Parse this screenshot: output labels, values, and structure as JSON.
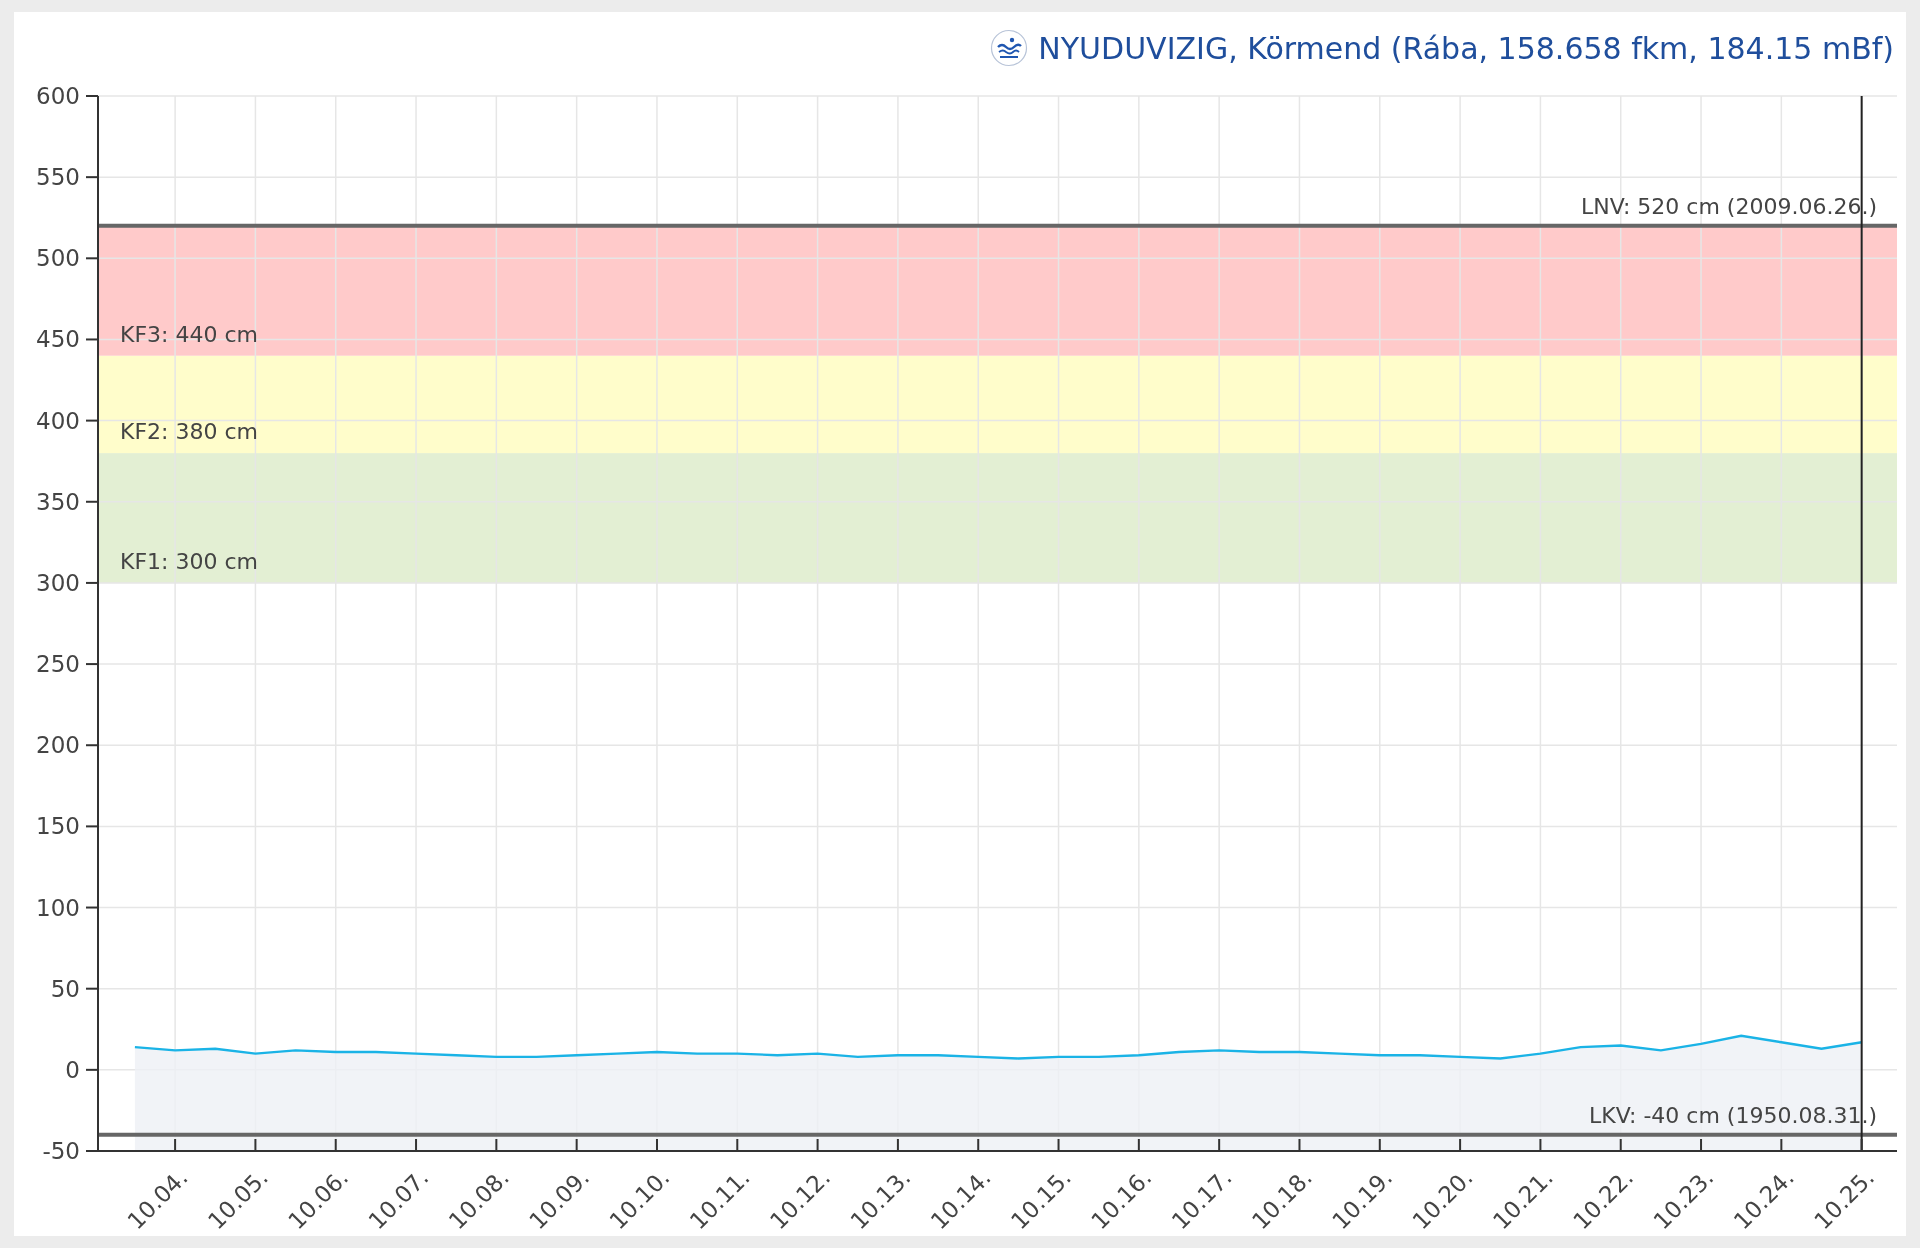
{
  "chart": {
    "chart_data": {
      "type": "line",
      "title": "NYUDUVIZIG, Körmend (Rába, 158.658 fkm, 184.15 mBf)",
      "categories": [
        null,
        "10.04.",
        null,
        "10.05.",
        null,
        "10.06.",
        null,
        "10.07.",
        null,
        "10.08.",
        null,
        "10.09.",
        null,
        "10.10.",
        null,
        "10.11.",
        null,
        "10.12.",
        null,
        "10.13.",
        null,
        "10.14.",
        null,
        "10.15.",
        null,
        "10.16.",
        null,
        "10.17.",
        null,
        "10.18.",
        null,
        "10.19.",
        null,
        "10.20.",
        null,
        "10.21.",
        null,
        "10.22.",
        null,
        "10.23.",
        null,
        "10.24.",
        null,
        "10.25."
      ],
      "series": [
        {
          "color": "#1ab3e6",
          "values": [
            14,
            12,
            13,
            10,
            12,
            11,
            11,
            10,
            9,
            8,
            8,
            9,
            10,
            11,
            10,
            10,
            9,
            10,
            8,
            9,
            9,
            8,
            7,
            8,
            8,
            9,
            11,
            12,
            11,
            11,
            10,
            9,
            9,
            8,
            7,
            10,
            14,
            15,
            12,
            16,
            21,
            17,
            13,
            17
          ]
        }
      ],
      "ylim": [
        -50,
        600
      ],
      "yticks": [
        -50,
        0,
        50,
        100,
        150,
        200,
        250,
        300,
        350,
        400,
        450,
        500,
        550,
        600
      ],
      "bands": [
        {
          "axis": "y",
          "from": 300,
          "to": 380,
          "label": "KF1: 300 cm",
          "color": "#e3efd3"
        },
        {
          "axis": "y",
          "from": 380,
          "to": 440,
          "label": "KF2: 380 cm",
          "color": "#fffdcb"
        },
        {
          "axis": "y",
          "from": 440,
          "to": 520,
          "label": "KF3: 440 cm",
          "color": "#ffcaca"
        }
      ],
      "ref_lines": [
        {
          "axis": "y",
          "value": 520,
          "label": "LNV: 520 cm (2009.06.26.)"
        },
        {
          "axis": "y",
          "value": -40,
          "label": "LKV: -40 cm (1950.08.31.)"
        }
      ],
      "grid": true
    }
  }
}
